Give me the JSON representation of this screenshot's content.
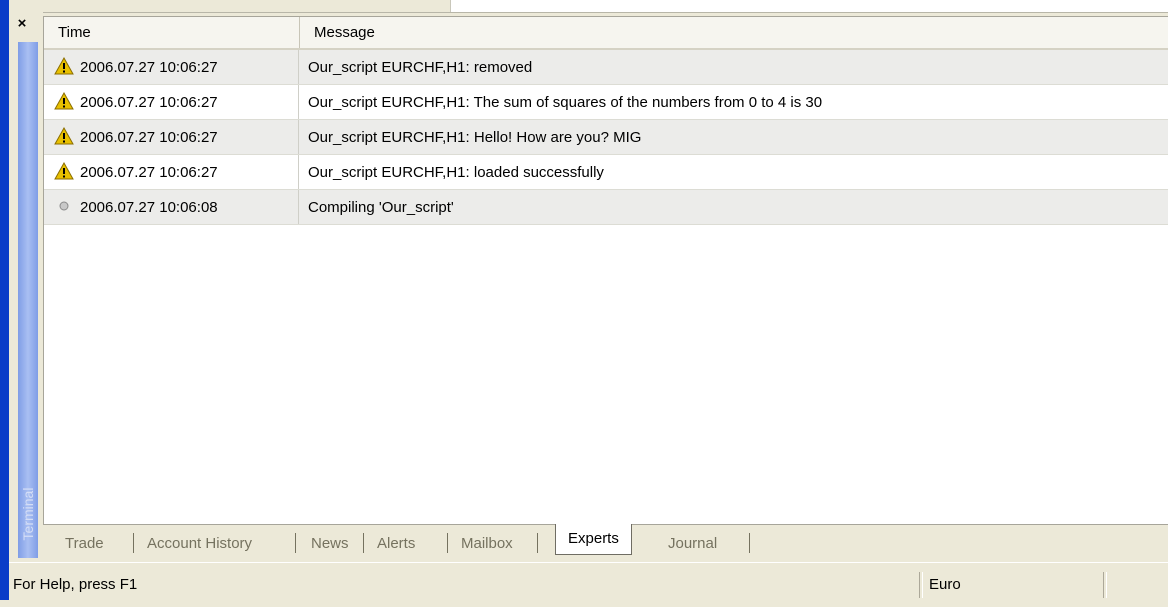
{
  "window": {
    "close_glyph": "×",
    "panel_title": "Terminal"
  },
  "columns": {
    "time": "Time",
    "message": "Message"
  },
  "rows": [
    {
      "icon": "warning-icon",
      "time": "2006.07.27 10:06:27",
      "message": "Our_script EURCHF,H1: removed"
    },
    {
      "icon": "warning-icon",
      "time": "2006.07.27 10:06:27",
      "message": "Our_script EURCHF,H1: The sum of squares of the numbers from 0 to 4 is 30"
    },
    {
      "icon": "warning-icon",
      "time": "2006.07.27 10:06:27",
      "message": "Our_script EURCHF,H1: Hello! How are you? MIG"
    },
    {
      "icon": "warning-icon",
      "time": "2006.07.27 10:06:27",
      "message": "Our_script EURCHF,H1: loaded successfully"
    },
    {
      "icon": "info-dot-icon",
      "time": "2006.07.27 10:06:08",
      "message": "Compiling 'Our_script'"
    }
  ],
  "tabs": [
    {
      "label": "Trade",
      "active": false
    },
    {
      "label": "Account History",
      "active": false
    },
    {
      "label": "News",
      "active": false
    },
    {
      "label": "Alerts",
      "active": false
    },
    {
      "label": "Mailbox",
      "active": false
    },
    {
      "label": "Experts",
      "active": true
    },
    {
      "label": "Journal",
      "active": false
    }
  ],
  "status": {
    "help": "For Help, press F1",
    "profile": "Euro"
  },
  "colors": {
    "title_bar": "#7f9de6",
    "left_edge": "#0a3cc8",
    "warning": "#e8c000",
    "alt_row": "#ececea"
  }
}
